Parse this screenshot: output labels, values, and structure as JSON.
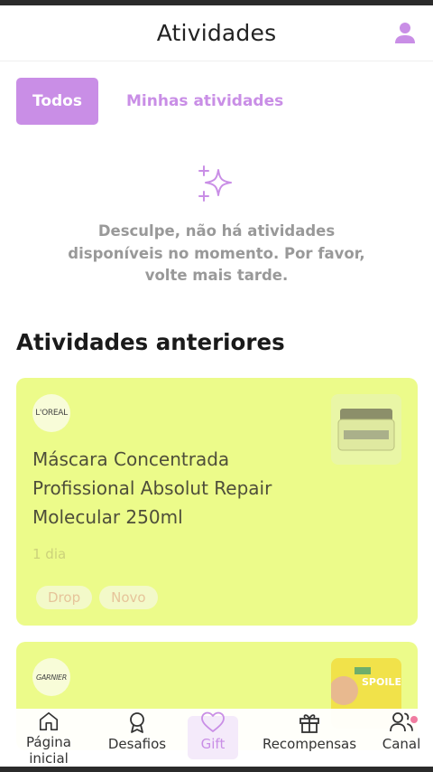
{
  "header": {
    "title": "Atividades",
    "user_icon": "user-icon"
  },
  "tabs": [
    {
      "label": "Todos",
      "active": true
    },
    {
      "label": "Minhas atividades",
      "active": false
    }
  ],
  "empty_state": {
    "icon": "sparkle-icon",
    "message": "Desculpe, não há atividades disponíveis no momento. Por favor, volte mais tarde."
  },
  "previous": {
    "title": "Atividades anteriores",
    "cards": [
      {
        "brand": "L'OREAL",
        "title": "Máscara Concentrada Profissional Absolut Repair Molecular 250ml",
        "time": "1 dia",
        "tags": [
          "Drop",
          "Novo"
        ]
      },
      {
        "brand": "GARNIER",
        "product_text": "SPOILE"
      }
    ]
  },
  "nav": [
    {
      "label": "Página inicial",
      "icon": "home-icon"
    },
    {
      "label": "Desafios",
      "icon": "badge-icon"
    },
    {
      "label": "Gift",
      "icon": "heart-icon",
      "active": true
    },
    {
      "label": "Recompensas",
      "icon": "gift-icon"
    },
    {
      "label": "Canal",
      "icon": "users-icon",
      "notification": true
    }
  ],
  "colors": {
    "accent": "#c98ee6",
    "card": "#ecfb8a",
    "tag_text": "#e6c49a"
  }
}
